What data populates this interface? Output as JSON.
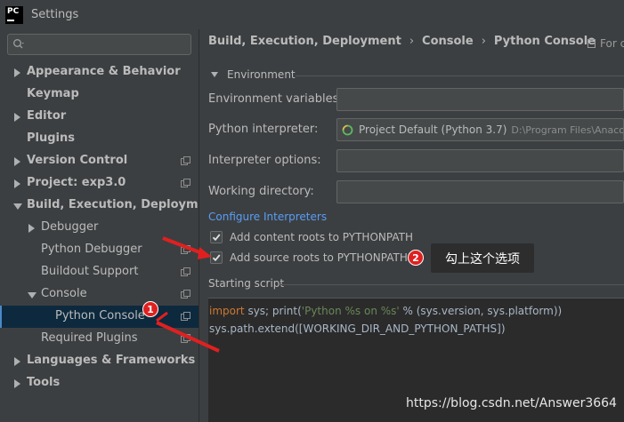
{
  "window": {
    "title": "Settings",
    "logo_text": "PC"
  },
  "search": {
    "placeholder": "",
    "value": ""
  },
  "sidebar": {
    "items": [
      {
        "label": "Appearance & Behavior"
      },
      {
        "label": "Keymap"
      },
      {
        "label": "Editor"
      },
      {
        "label": "Plugins"
      },
      {
        "label": "Version Control"
      },
      {
        "label": "Project: exp3.0"
      },
      {
        "label": "Build, Execution, Deployment"
      },
      {
        "label": "Debugger"
      },
      {
        "label": "Python Debugger"
      },
      {
        "label": "Buildout Support"
      },
      {
        "label": "Console"
      },
      {
        "label": "Python Console"
      },
      {
        "label": "Required Plugins"
      },
      {
        "label": "Languages & Frameworks"
      },
      {
        "label": "Tools"
      }
    ]
  },
  "breadcrumb": {
    "parts": [
      "Build, Execution, Deployment",
      "Console",
      "Python Console"
    ],
    "separator": "›",
    "for_label": "For c"
  },
  "environment": {
    "title": "Environment",
    "env_vars_label": "Environment variables:",
    "env_vars_value": "",
    "interpreter_label": "Python interpreter:",
    "interpreter_name": "Project Default (Python 3.7)",
    "interpreter_path": "D:\\Program Files\\Anacond",
    "interp_options_label": "Interpreter options:",
    "interp_options_value": "",
    "working_dir_label": "Working directory:",
    "working_dir_value": "",
    "configure_link": "Configure Interpreters",
    "add_content_roots_label": "Add content roots to PYTHONPATH",
    "add_content_roots_checked": true,
    "add_source_roots_label": "Add source roots to PYTHONPATH",
    "add_source_roots_checked": true
  },
  "starting_script": {
    "title": "Starting script",
    "line1": {
      "kw": "import",
      "t1": " sys; ",
      "fn": "print",
      "t2": "(",
      "str": "'Python %s on %s'",
      "t3": " % (sys.version, sys.platform))"
    },
    "line2": "sys.path.extend([WORKING_DIR_AND_PYTHON_PATHS])"
  },
  "annotation": {
    "tip_text": "勾上这个选项",
    "badge1": "1",
    "badge2": "2"
  },
  "watermark": "https://blog.csdn.net/Answer3664",
  "colors": {
    "background": "#3c3f41",
    "selection": "#0d293e",
    "link": "#589df6",
    "badge": "#e02020",
    "annotation_arrow": "#e02020"
  }
}
